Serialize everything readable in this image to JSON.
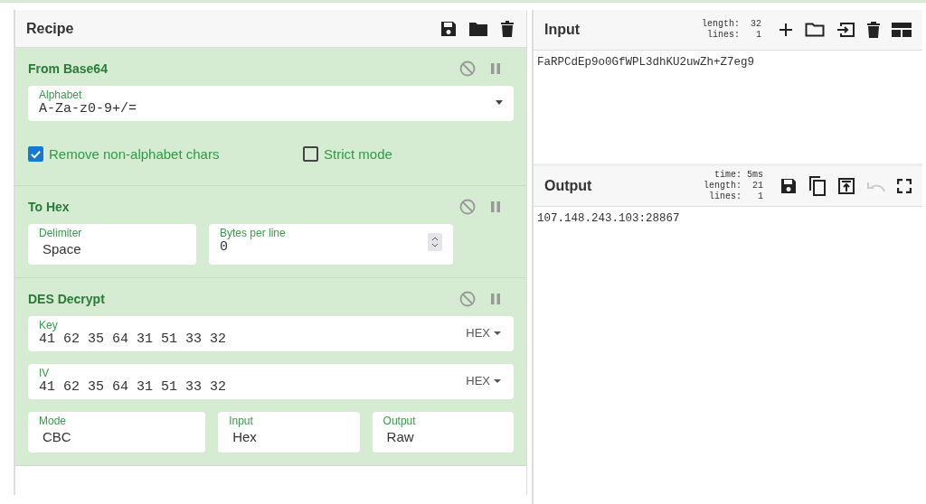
{
  "recipe": {
    "title": "Recipe",
    "operations": [
      {
        "name": "From Base64",
        "disabled": false,
        "paused": false,
        "rows": [
          [
            {
              "kind": "dropdown",
              "label": "Alphabet",
              "value": "A-Za-z0-9+/="
            }
          ],
          [
            {
              "kind": "checkbox",
              "label": "Remove non-alphabet chars",
              "checked": true
            },
            {
              "kind": "checkbox",
              "label": "Strict mode",
              "checked": false
            }
          ]
        ]
      },
      {
        "name": "To Hex",
        "disabled": false,
        "paused": false,
        "rows": [
          [
            {
              "kind": "select",
              "label": "Delimiter",
              "value": "Space"
            },
            {
              "kind": "number",
              "label": "Bytes per line",
              "value": "0"
            }
          ]
        ]
      },
      {
        "name": "DES Decrypt",
        "disabled": false,
        "paused": false,
        "rows": [
          [
            {
              "kind": "toggle",
              "label": "Key",
              "value": "41 62 35 64 31 51 33 32",
              "option": "HEX"
            }
          ],
          [
            {
              "kind": "toggle",
              "label": "IV",
              "value": "41 62 35 64 31 51 33 32",
              "option": "HEX"
            }
          ],
          [
            {
              "kind": "select",
              "label": "Mode",
              "value": "CBC"
            },
            {
              "kind": "select",
              "label": "Input",
              "value": "Hex"
            },
            {
              "kind": "select",
              "label": "Output",
              "value": "Raw"
            }
          ]
        ]
      }
    ]
  },
  "input": {
    "title": "Input",
    "stats": [
      {
        "label": "length:",
        "value": "32"
      },
      {
        "label": "lines:",
        "value": "1"
      }
    ],
    "text": "FaRPCdEp9o0GfWPL3dhKU2uwZh+Z7eg9"
  },
  "output": {
    "title": "Output",
    "stats": [
      {
        "label": "time:",
        "value": "5ms"
      },
      {
        "label": "length:",
        "value": "21"
      },
      {
        "label": "lines:",
        "value": "1"
      }
    ],
    "text": "107.148.243.103:28867"
  }
}
